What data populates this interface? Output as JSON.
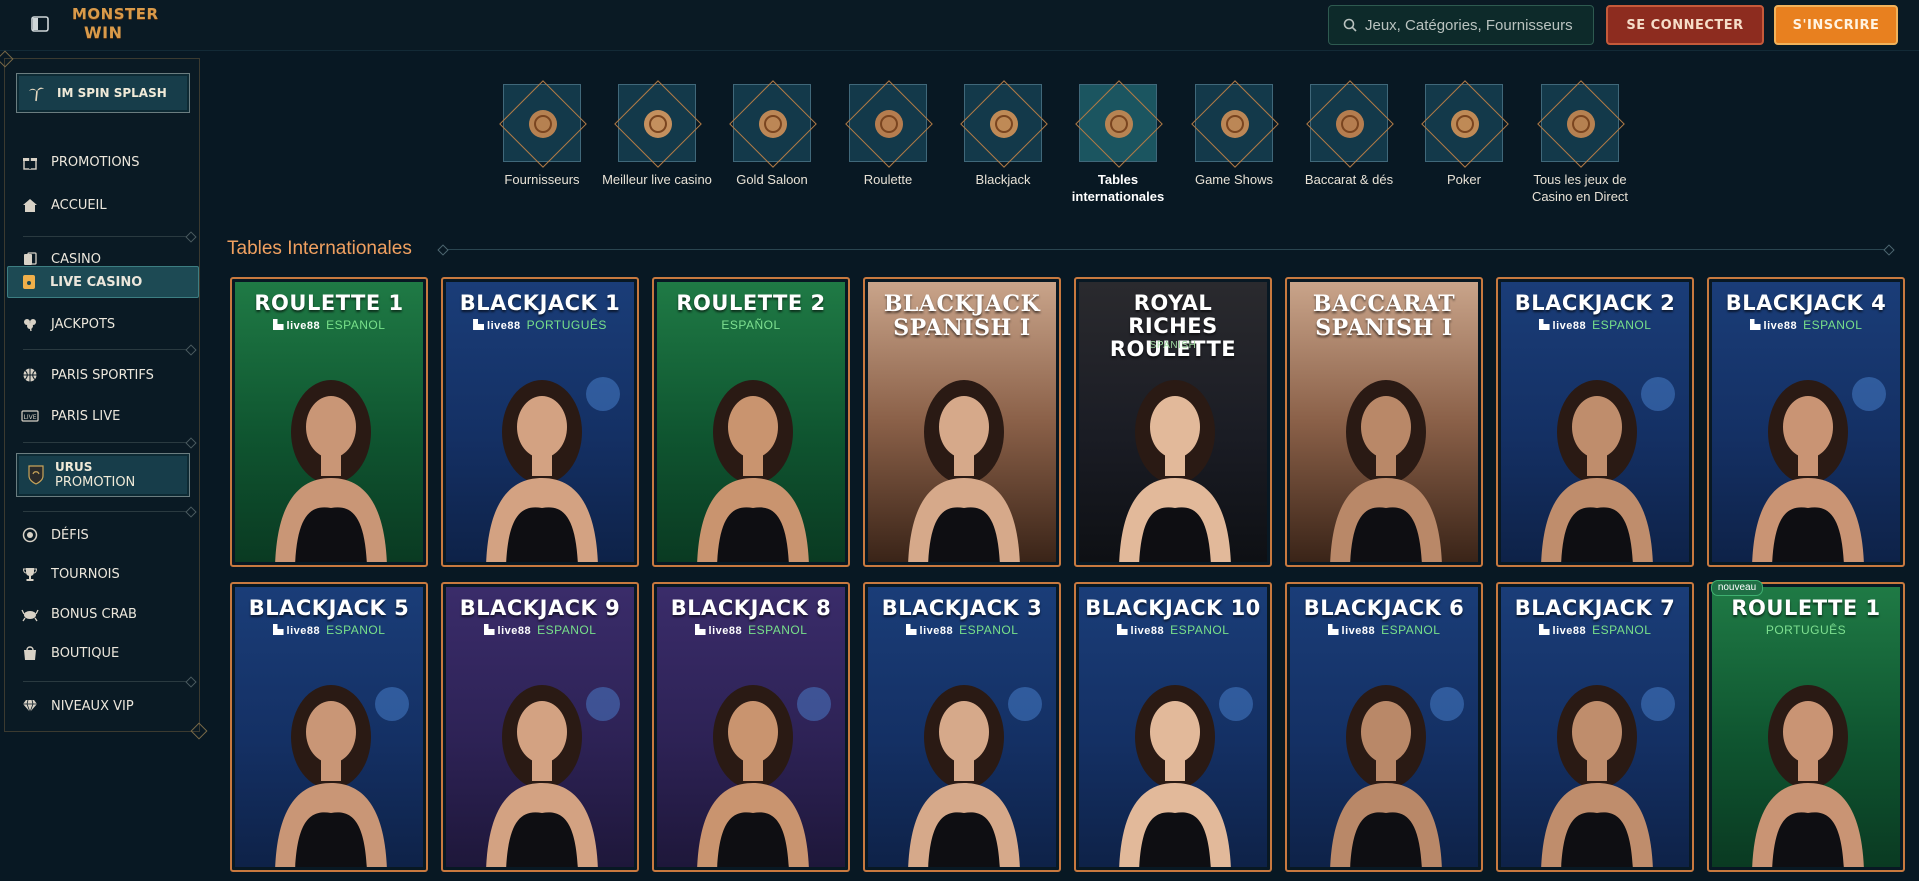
{
  "header": {
    "logo_line1": "MONSTER",
    "logo_line2": "WIN",
    "search_placeholder": "Jeux, Catégories, Fournisseurs",
    "login_label": "SE CONNECTER",
    "signup_label": "S'INSCRIRE"
  },
  "sidebar": {
    "promo_top": "IM SPIN SPLASH",
    "items": [
      {
        "label": "PROMOTIONS",
        "icon": "gift-icon"
      },
      {
        "label": "ACCUEIL",
        "icon": "home-icon"
      },
      {
        "label": "CASINO",
        "icon": "cards-icon"
      },
      {
        "label": "LIVE CASINO",
        "icon": "live-card-icon"
      },
      {
        "label": "JACKPOTS",
        "icon": "clover-icon"
      },
      {
        "label": "PARIS SPORTIFS",
        "icon": "basketball-icon"
      },
      {
        "label": "PARIS LIVE",
        "icon": "live-badge-icon"
      },
      {
        "label": "DÉFIS",
        "icon": "target-icon"
      },
      {
        "label": "TOURNOIS",
        "icon": "trophy-icon"
      },
      {
        "label": "BONUS CRAB",
        "icon": "crab-icon"
      },
      {
        "label": "BOUTIQUE",
        "icon": "shopping-bag-icon"
      },
      {
        "label": "NIVEAUX VIP",
        "icon": "diamond-icon"
      }
    ],
    "promo_urus_line1": "URUS",
    "promo_urus_line2": "PROMOTION"
  },
  "categories": [
    {
      "label": "Fournisseurs"
    },
    {
      "label": "Meilleur live casino"
    },
    {
      "label": "Gold Saloon"
    },
    {
      "label": "Roulette"
    },
    {
      "label": "Blackjack"
    },
    {
      "label": "Tables internationales",
      "active": true
    },
    {
      "label": "Game Shows"
    },
    {
      "label": "Baccarat & dés"
    },
    {
      "label": "Poker"
    },
    {
      "label": "Tous les jeux de Casino en Direct"
    }
  ],
  "section": {
    "title": "Tables Internationales"
  },
  "games": [
    {
      "title": "ROULETTE 1",
      "brand": "live88",
      "lang": "ESPANOL",
      "theme": "green"
    },
    {
      "title": "BLACKJACK 1",
      "brand": "live88",
      "lang": "PORTUGUÊS",
      "theme": "blue"
    },
    {
      "title": "ROULETTE 2",
      "brand": "",
      "lang": "ESPAÑOL",
      "theme": "green"
    },
    {
      "title": "BLACKJACK SPANISH I",
      "brand": "",
      "lang": "",
      "theme": "warm"
    },
    {
      "title": "ROYAL RICHES ROULETTE",
      "brand": "",
      "lang": "SPANISH",
      "theme": "dark"
    },
    {
      "title": "BACCARAT SPANISH I",
      "brand": "",
      "lang": "",
      "theme": "warm"
    },
    {
      "title": "BLACKJACK 2",
      "brand": "live88",
      "lang": "ESPANOL",
      "theme": "blue"
    },
    {
      "title": "BLACKJACK 4",
      "brand": "live88",
      "lang": "ESPANOL",
      "theme": "blue"
    },
    {
      "title": "BLACKJACK 5",
      "brand": "live88",
      "lang": "ESPANOL",
      "theme": "blue"
    },
    {
      "title": "BLACKJACK 9",
      "brand": "live88",
      "lang": "ESPANOL",
      "theme": "purple"
    },
    {
      "title": "BLACKJACK 8",
      "brand": "live88",
      "lang": "ESPANOL",
      "theme": "purple"
    },
    {
      "title": "BLACKJACK 3",
      "brand": "live88",
      "lang": "ESPANOL",
      "theme": "blue"
    },
    {
      "title": "BLACKJACK 10",
      "brand": "live88",
      "lang": "ESPANOL",
      "theme": "blue"
    },
    {
      "title": "BLACKJACK 6",
      "brand": "live88",
      "lang": "ESPANOL",
      "theme": "blue"
    },
    {
      "title": "BLACKJACK 7",
      "brand": "live88",
      "lang": "ESPANOL",
      "theme": "blue"
    },
    {
      "title": "ROULETTE 1",
      "brand": "",
      "lang": "PORTUGUÊS",
      "theme": "green",
      "badge": "nouveau"
    }
  ],
  "colors": {
    "background": "#081823",
    "accent_orange": "#e8801f",
    "login_red": "#8d2c1f",
    "section_title": "#f0a060",
    "card_border": "#c8793f",
    "lang_green": "#78e08a"
  }
}
